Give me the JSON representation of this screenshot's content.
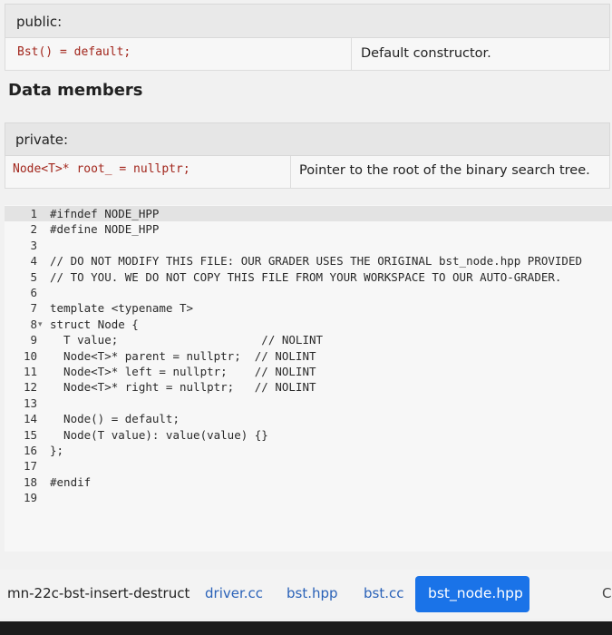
{
  "public_table": {
    "header": "public:",
    "code": "Bst() = default;",
    "description": "Default constructor."
  },
  "data_members_heading": "Data members",
  "private_table": {
    "header": "private:",
    "code": "Node<T>* root_ = nullptr;",
    "description": "Pointer to the root of the binary search tree."
  },
  "editor": {
    "lines": [
      {
        "n": "1",
        "text": "#ifndef NODE_HPP"
      },
      {
        "n": "2",
        "text": "#define NODE_HPP"
      },
      {
        "n": "3",
        "text": ""
      },
      {
        "n": "4",
        "text": "// DO NOT MODIFY THIS FILE: OUR GRADER USES THE ORIGINAL bst_node.hpp PROVIDED"
      },
      {
        "n": "5",
        "text": "// TO YOU. WE DO NOT COPY THIS FILE FROM YOUR WORKSPACE TO OUR AUTO-GRADER."
      },
      {
        "n": "6",
        "text": ""
      },
      {
        "n": "7",
        "text": "template <typename T>"
      },
      {
        "n": "8",
        "text": "struct Node {"
      },
      {
        "n": "9",
        "text": "  T value;                     // NOLINT"
      },
      {
        "n": "10",
        "text": "  Node<T>* parent = nullptr;  // NOLINT"
      },
      {
        "n": "11",
        "text": "  Node<T>* left = nullptr;    // NOLINT"
      },
      {
        "n": "12",
        "text": "  Node<T>* right = nullptr;   // NOLINT"
      },
      {
        "n": "13",
        "text": ""
      },
      {
        "n": "14",
        "text": "  Node() = default;"
      },
      {
        "n": "15",
        "text": "  Node(T value): value(value) {}"
      },
      {
        "n": "16",
        "text": "};"
      },
      {
        "n": "17",
        "text": ""
      },
      {
        "n": "18",
        "text": "#endif"
      },
      {
        "n": "19",
        "text": ""
      }
    ]
  },
  "tabs": {
    "project": "mn-22c-bst-insert-destruct",
    "driver": "driver.cc",
    "bst_hpp": "bst.hpp",
    "bst_cc": "bst.cc",
    "active": "bst_node.hpp",
    "overflow": "C"
  },
  "colors": {
    "code_red": "#a2261c",
    "link_blue": "#2a62b8",
    "active_tab": "#1a73e8"
  }
}
